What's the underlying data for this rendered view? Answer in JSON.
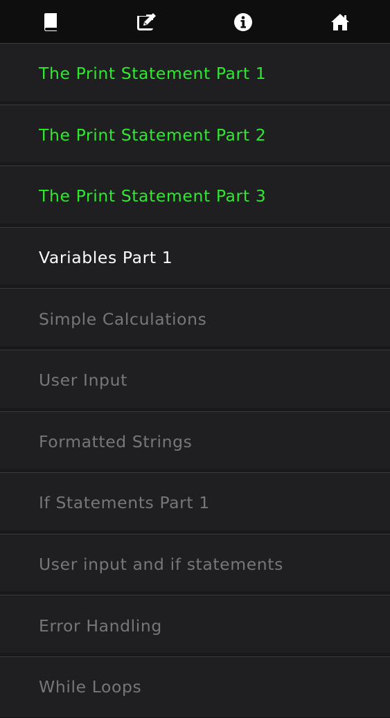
{
  "toolbar": {
    "icons": [
      "book-icon",
      "edit-icon",
      "info-icon",
      "home-icon"
    ]
  },
  "colors": {
    "completed": "#2fe82f",
    "current": "#ffffff",
    "locked": "#77777a",
    "background": "#1f1f21",
    "toolbar_bg": "#0e0e0f"
  },
  "lessons": [
    {
      "label": "The Print Statement Part 1",
      "status": "completed"
    },
    {
      "label": "The Print Statement Part 2",
      "status": "completed"
    },
    {
      "label": "The Print Statement Part 3",
      "status": "completed"
    },
    {
      "label": "Variables Part 1",
      "status": "current"
    },
    {
      "label": "Simple Calculations",
      "status": "locked"
    },
    {
      "label": "User Input",
      "status": "locked"
    },
    {
      "label": "Formatted Strings",
      "status": "locked"
    },
    {
      "label": "If Statements Part 1",
      "status": "locked"
    },
    {
      "label": "User input and if statements",
      "status": "locked"
    },
    {
      "label": "Error Handling",
      "status": "locked"
    },
    {
      "label": "While Loops",
      "status": "locked"
    }
  ]
}
